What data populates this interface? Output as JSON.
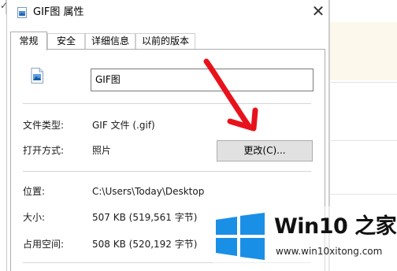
{
  "dialog": {
    "title": "GIF图 属性",
    "close_glyph": "✕",
    "tabs": [
      "常规",
      "安全",
      "详细信息",
      "以前的版本"
    ],
    "file_name": "GIF图",
    "file_icon": "image-file-icon",
    "rows": {
      "type_label": "文件类型:",
      "type_value": "GIF 文件 (.gif)",
      "open_label": "打开方式:",
      "open_value": "照片",
      "change_button": "更改(C)...",
      "location_label": "位置:",
      "location_value": "C:\\Users\\Today\\Desktop",
      "size_label": "大小:",
      "size_value": "507 KB (519,561 字节)",
      "disk_label": "占用空间:",
      "disk_value": "508 KB (520,192 字节)"
    }
  },
  "annotation": {
    "arrow_color": "#e8121c"
  },
  "watermark": {
    "title": "Win10 之家",
    "url": "www.win10xitong.com",
    "logo_color": "#1a8fe6"
  },
  "background": {
    "tick_glyph": "✓"
  }
}
